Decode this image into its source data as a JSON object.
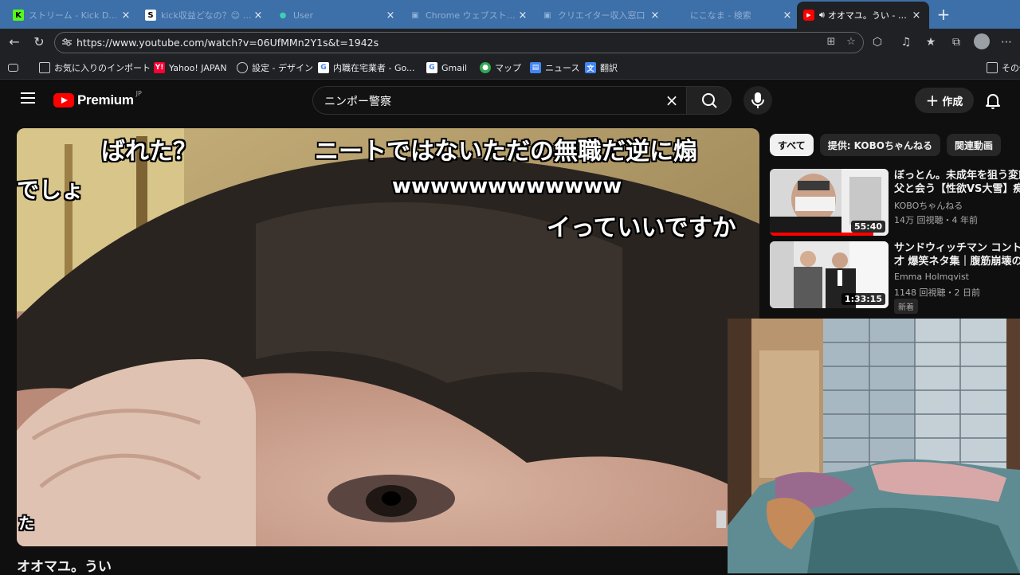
{
  "browser": {
    "tabs": [
      {
        "title": "ストリーム - Kick Dashboard",
        "fav": "K",
        "active": false
      },
      {
        "title": "kick収益どなの？😊 An",
        "fav": "S",
        "active": false
      },
      {
        "title": "User",
        "fav": "●",
        "active": false
      },
      {
        "title": "Chrome ウェブストア - 拡張",
        "fav": "▣",
        "active": false
      },
      {
        "title": "クリエイター収入窓口",
        "fav": "▣",
        "active": false
      },
      {
        "title": "にこなま - 検索",
        "fav": "",
        "active": false
      },
      {
        "title": "オオマユ。うい - YouTube",
        "fav": "▶",
        "active": true
      }
    ],
    "url": "https://www.youtube.com/watch?v=06UfMMn2Y1s&t=1942s",
    "bookmarks": [
      "お気に入りのインポート",
      "Yahoo! JAPAN",
      "設定 - デザイン",
      "内職在宅業者 - Go...",
      "Gmail",
      "マップ",
      "ニュース",
      "翻訳",
      "その他"
    ]
  },
  "youtube": {
    "logo_text": "Premium",
    "logo_region": "JP",
    "search_query": "ニンポー警察",
    "create_label": "作成",
    "video_title": "オオマユ。うい",
    "subtitles": [
      "ばれた？",
      "ニートではないただの無職だ逆に煽",
      "でしょ",
      "wwwwwwwwwwww",
      "イっていいですか",
      "た"
    ],
    "chips": [
      "すべて",
      "提供: KOBOちゃんねる",
      "関連動画"
    ],
    "recommendations": [
      {
        "title_line1": "ぼっとん。未成年を狙う変態",
        "title_line2": "父と会う【性欲VS大雪】痴態",
        "channel": "KOBOちゃんねる",
        "meta": "14万 回視聴・4 年前",
        "duration": "55:40",
        "badge": ""
      },
      {
        "title_line1": "サンドウィッチマン コント・",
        "title_line2": "才 爆笑ネタ集｜腹筋崩壊の",
        "channel": "Emma Holmqvist",
        "meta": "1148 回視聴・2 日前",
        "duration": "1:33:15",
        "badge": "新着"
      }
    ]
  },
  "colors": {
    "tab_strip": "#3d6fa8",
    "yt_red": "#ff0000",
    "background": "#0f0f0f"
  }
}
